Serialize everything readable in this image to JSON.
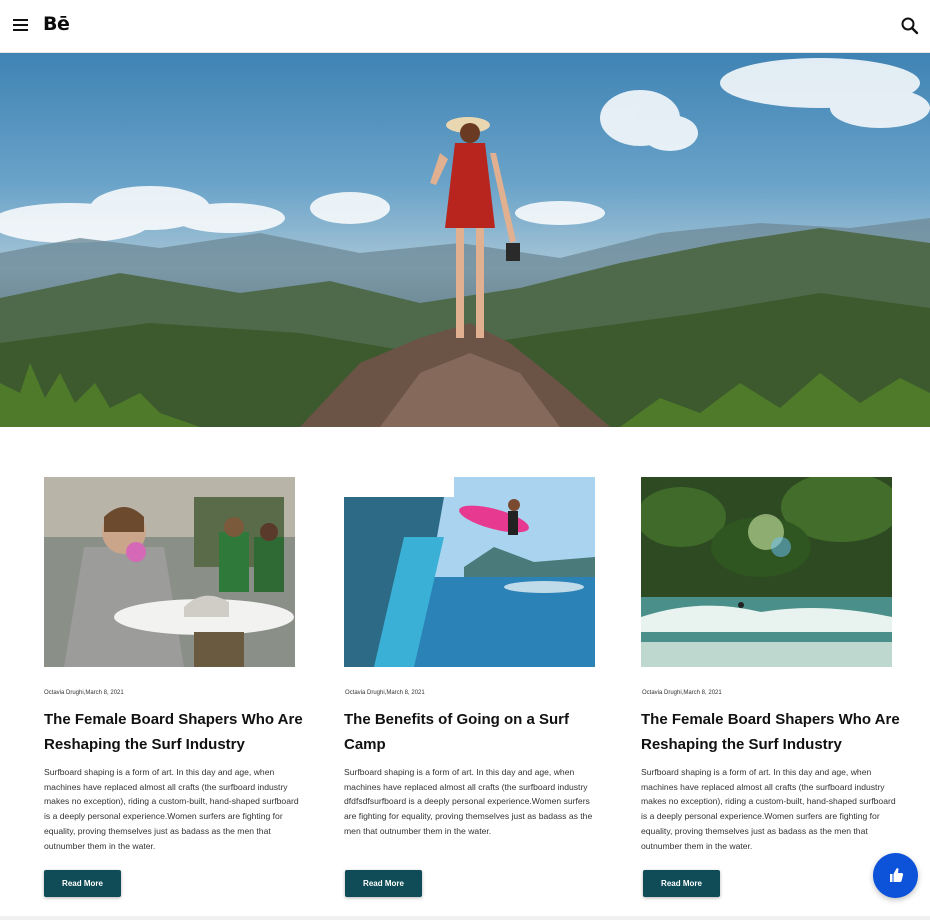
{
  "header": {
    "logo": "Bē",
    "menu_icon": "hamburger-menu-icon",
    "search_icon": "search-icon"
  },
  "hero": {
    "image": "woman-on-mountain-peak-photo"
  },
  "cards": [
    {
      "image": "female-board-shaper-photo",
      "meta": "Octavia Drughi,March 8, 2021",
      "title": "The Female Board Shapers Who Are Reshaping the Surf Industry",
      "body": "Surfboard shaping is a form of art. In this day and age, when machines have replaced almost all crafts (the surfboard industry makes no exception), riding a custom-built, hand-shaped surfboard is a deeply personal experience.Women surfers are fighting for equality, proving themselves just as badass as the men that outnumber them in the water.",
      "button": "Read More"
    },
    {
      "image": "surfer-jumping-off-boat-photo",
      "meta": "Octavia Drughi,March 8, 2021",
      "title": "The Benefits of Going on a Surf Camp",
      "body": "Surfboard shaping is a form of art. In this day and age, when machines have replaced almost all crafts (the surfboard industry dfdfsdfsurfboard is a deeply personal experience.Women surfers are fighting for equality, proving themselves just as badass as the men that outnumber them in the water.",
      "button": "Read More"
    },
    {
      "image": "surfer-tropical-beach-photo",
      "meta": "Octavia Drughi,March 8, 2021",
      "title": "The Female Board Shapers Who Are Reshaping the Surf Industry",
      "body": "Surfboard shaping is a form of art. In this day and age, when machines have replaced almost all crafts (the surfboard industry makes no exception), riding a custom-built, hand-shaped surfboard is a deeply personal experience.Women surfers are fighting for equality, proving themselves just as badass as the men that outnumber them in the water.",
      "button": "Read More"
    }
  ],
  "appreciate": {
    "icon": "thumbs-up-icon"
  },
  "colors": {
    "button_bg": "#0f4c57",
    "appreciate_bg": "#0d53d9"
  }
}
